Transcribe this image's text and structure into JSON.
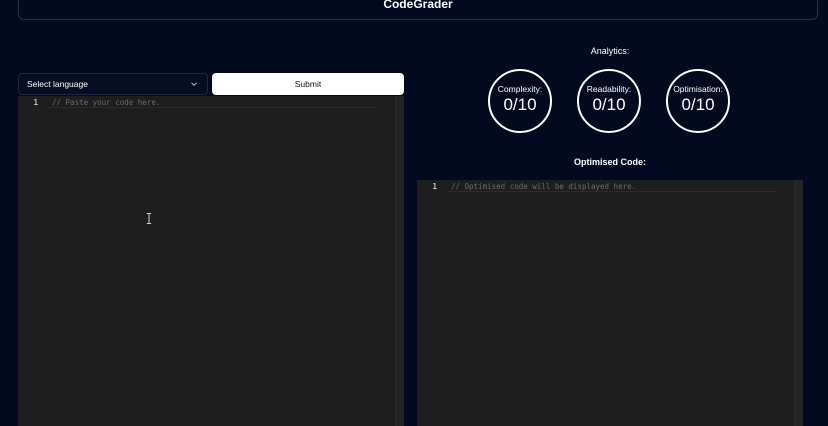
{
  "header": {
    "title": "CodeGrader"
  },
  "input_panel": {
    "language_select": {
      "selected": "Select language",
      "icon": "chevron-down-icon"
    },
    "submit_label": "Submit",
    "editor": {
      "line_number": "1",
      "placeholder": "// Paste your code here."
    }
  },
  "analytics": {
    "title": "Analytics:",
    "metrics": [
      {
        "label": "Complexity:",
        "value": "0/10"
      },
      {
        "label": "Readability:",
        "value": "0/10"
      },
      {
        "label": "Optimisation:",
        "value": "0/10"
      }
    ]
  },
  "output_panel": {
    "title": "Optimised Code:",
    "editor": {
      "line_number": "1",
      "placeholder": "// Optimised code will be displayed here."
    }
  },
  "colors": {
    "background": "#030a1f",
    "editor_background": "#1e1e1e",
    "button_background": "#ffffff",
    "text": "#ffffff"
  }
}
